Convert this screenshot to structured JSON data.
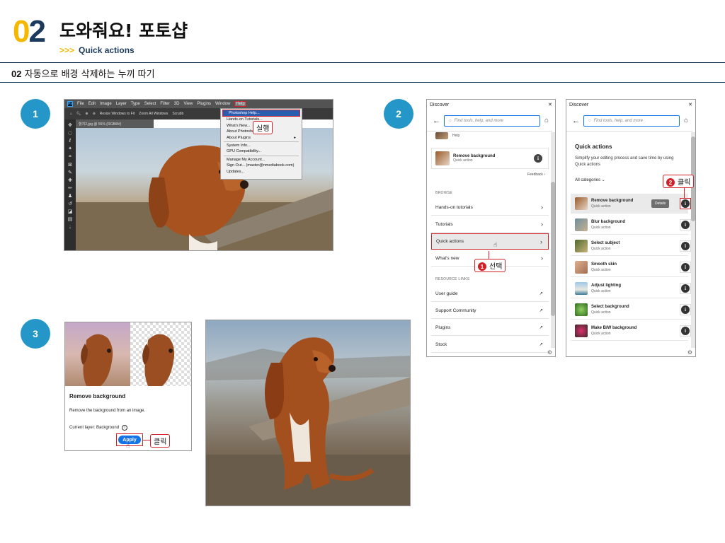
{
  "header": {
    "number_a": "0",
    "number_b": "2",
    "title": "도와줘요! 포토샵",
    "sub_arrows": ">>>",
    "subtitle": "Quick actions"
  },
  "section": {
    "num": "02",
    "title": "자동으로 배경 삭제하는 누끼 따기"
  },
  "steps": [
    "1",
    "2",
    "3"
  ],
  "ps": {
    "menu": [
      "File",
      "Edit",
      "Image",
      "Layer",
      "Type",
      "Select",
      "Filter",
      "3D",
      "View",
      "Plugins",
      "Window",
      "Help"
    ],
    "options": [
      "Resize Windows to Fit",
      "Zoom All Windows",
      "Scrubb"
    ],
    "tab": "혈지2.jpg @ 55% (RGB/8#)",
    "help_items": [
      "Photoshop Help...",
      "Hands-on Tutorials...",
      "What's New...",
      "About Photoshop...",
      "About Plugins",
      "System Info...",
      "GPU Compatibility...",
      "Manage My Account...",
      "Sign Out... (master@nmediabook.com)",
      "Updates..."
    ],
    "callout": "실행"
  },
  "discover1": {
    "title": "Discover",
    "search_placeholder": "Find tools, help, and more",
    "help_small": "Help",
    "remove_bg": {
      "title": "Remove background",
      "sub": "Quick action"
    },
    "feedback": "Feedback",
    "browse_label": "BROWSE",
    "browse": [
      "Hands-on tutorials",
      "Tutorials",
      "Quick actions",
      "What's new"
    ],
    "resource_label": "RESOURCE LINKS",
    "resources": [
      "User guide",
      "Support Community",
      "Plugins",
      "Stock"
    ],
    "callout_num": "1",
    "callout": "선택"
  },
  "discover2": {
    "title": "Discover",
    "search_placeholder": "Find tools, help, and more",
    "heading": "Quick actions",
    "desc": "Simplify your editing process and save time by using Quick actions",
    "category": "All categories",
    "details": "Details",
    "items": [
      {
        "title": "Remove background",
        "sub": "Quick action"
      },
      {
        "title": "Blur background",
        "sub": "Quick action"
      },
      {
        "title": "Select subject",
        "sub": "Quick action"
      },
      {
        "title": "Smooth skin",
        "sub": "Quick action"
      },
      {
        "title": "Adjust lighting",
        "sub": "Quick action"
      },
      {
        "title": "Select background",
        "sub": "Quick action"
      },
      {
        "title": "Make B/W background",
        "sub": "Quick action"
      }
    ],
    "callout_num": "2",
    "callout": "클릭"
  },
  "remove_panel": {
    "title": "Remove background",
    "desc": "Remove the background from an image.",
    "layer": "Current layer: Background",
    "apply": "Apply",
    "callout": "클릭"
  },
  "colors": {
    "accent_blue": "#2596c8",
    "accent_yellow": "#f5b800",
    "navy": "#1b3a5c",
    "red": "#d0202a"
  }
}
